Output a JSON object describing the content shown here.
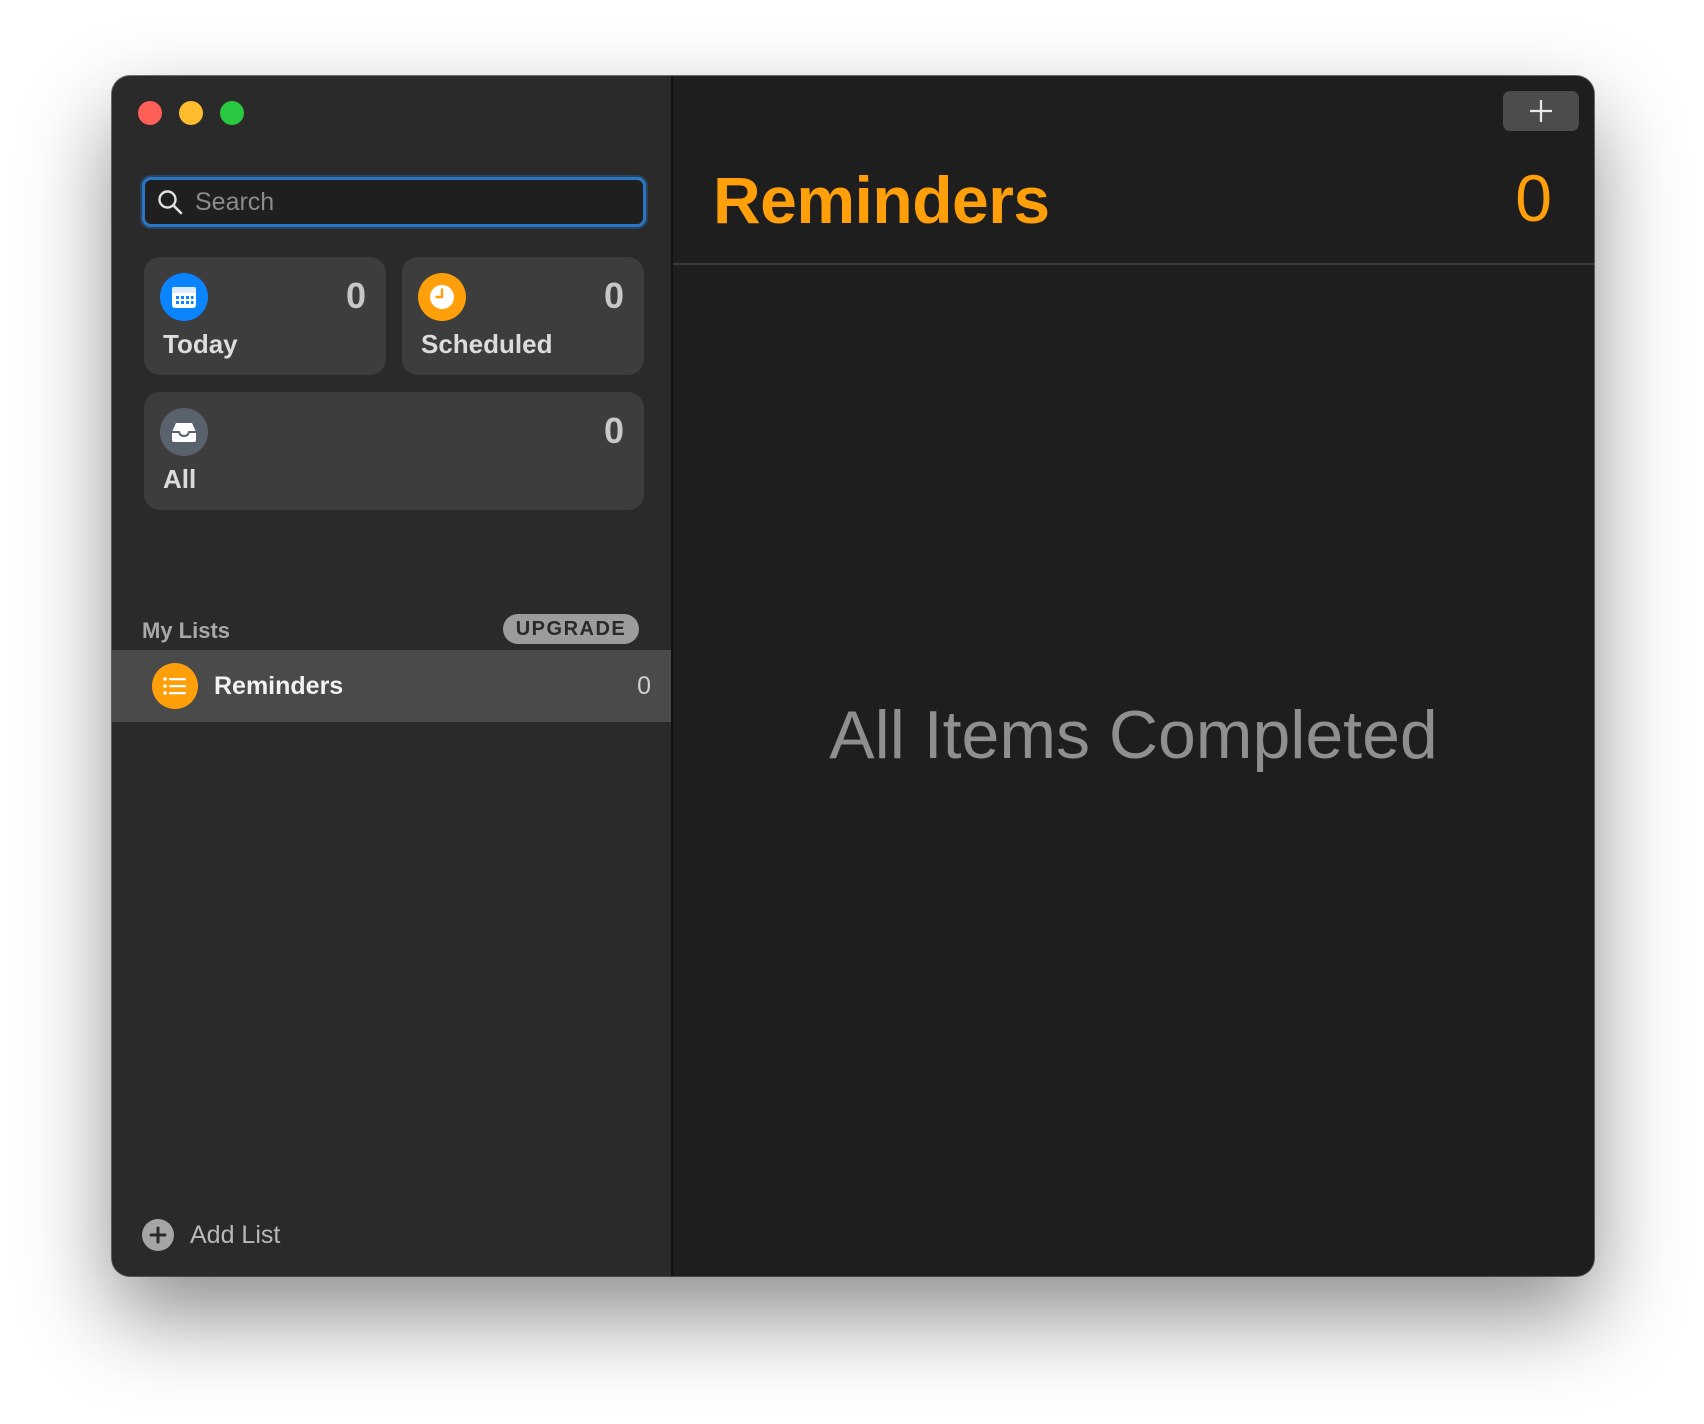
{
  "window": {
    "traffic_lights": [
      "close",
      "minimize",
      "zoom"
    ]
  },
  "sidebar": {
    "search": {
      "placeholder": "Search",
      "value": ""
    },
    "smart_lists": [
      {
        "label": "Today",
        "count": "0",
        "icon": "calendar-icon",
        "color": "#0a84ff"
      },
      {
        "label": "Scheduled",
        "count": "0",
        "icon": "clock-icon",
        "color": "#ff9f0a"
      },
      {
        "label": "All",
        "count": "0",
        "icon": "tray-icon",
        "color": "#5a626e"
      }
    ],
    "my_lists": {
      "title": "My Lists",
      "upgrade_label": "UPGRADE",
      "items": [
        {
          "label": "Reminders",
          "count": "0",
          "icon": "list-bullet-icon",
          "color": "#ff9f0a"
        }
      ]
    },
    "add_list_label": "Add List"
  },
  "main": {
    "title": "Reminders",
    "count": "0",
    "empty_message": "All Items Completed",
    "accent_color": "#ff9f0a"
  }
}
